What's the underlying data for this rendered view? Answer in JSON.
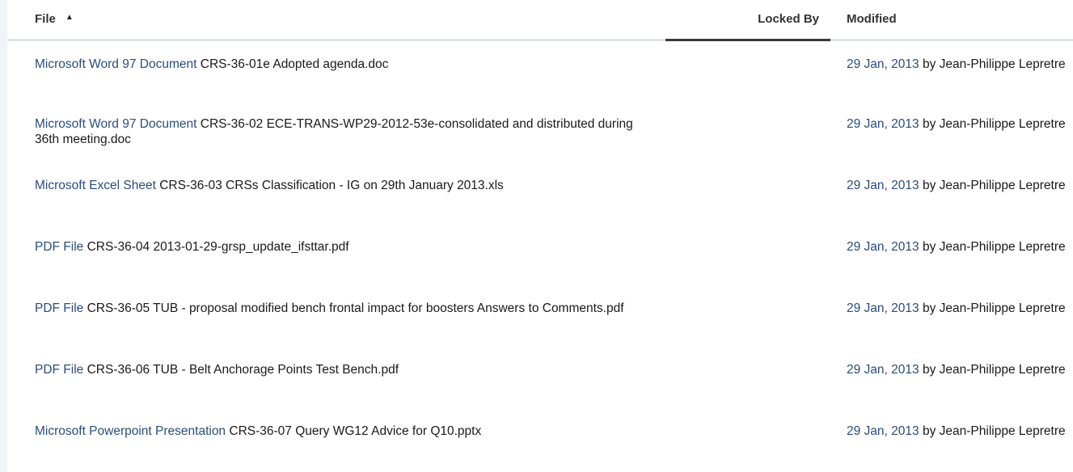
{
  "columns": {
    "file": "File",
    "locked_by": "Locked By",
    "modified": "Modified"
  },
  "sort": {
    "column": "File",
    "direction": "ascending",
    "icon": "sort-up-icon"
  },
  "rows": [
    {
      "type": "Microsoft Word 97 Document",
      "name": "CRS-36-01e Adopted agenda.doc",
      "locked_by": "",
      "date": "29 Jan, 2013",
      "by": "by",
      "user": "Jean-Philippe Lepretre"
    },
    {
      "type": "Microsoft Word 97 Document",
      "name": "CRS-36-02 ECE-TRANS-WP29-2012-53e-consolidated and distributed during 36th meeting.doc",
      "locked_by": "",
      "date": "29 Jan, 2013",
      "by": "by",
      "user": "Jean-Philippe Lepretre"
    },
    {
      "type": "Microsoft Excel Sheet",
      "name": "CRS-36-03 CRSs Classification - IG on 29th January 2013.xls",
      "locked_by": "",
      "date": "29 Jan, 2013",
      "by": "by",
      "user": "Jean-Philippe Lepretre"
    },
    {
      "type": "PDF File",
      "name": "CRS-36-04 2013-01-29-grsp_update_ifsttar.pdf",
      "locked_by": "",
      "date": "29 Jan, 2013",
      "by": "by",
      "user": "Jean-Philippe Lepretre"
    },
    {
      "type": "PDF File",
      "name": "CRS-36-05 TUB - proposal modified bench frontal impact for boosters Answers to Comments.pdf",
      "locked_by": "",
      "date": "29 Jan, 2013",
      "by": "by",
      "user": "Jean-Philippe Lepretre"
    },
    {
      "type": "PDF File",
      "name": "CRS-36-06 TUB - Belt Anchorage Points Test Bench.pdf",
      "locked_by": "",
      "date": "29 Jan, 2013",
      "by": "by",
      "user": "Jean-Philippe Lepretre"
    },
    {
      "type": "Microsoft Powerpoint Presentation",
      "name": "CRS-36-07 Query WG12 Advice for Q10.pptx",
      "locked_by": "",
      "date": "29 Jan, 2013",
      "by": "by",
      "user": "Jean-Philippe Lepretre"
    }
  ],
  "colors": {
    "link": "#2a4d7c",
    "text": "#1a1a1a",
    "header_rule": "#dfe3e8",
    "active_rule": "#3a3a3a",
    "left_strip": "#f0f4f8"
  }
}
